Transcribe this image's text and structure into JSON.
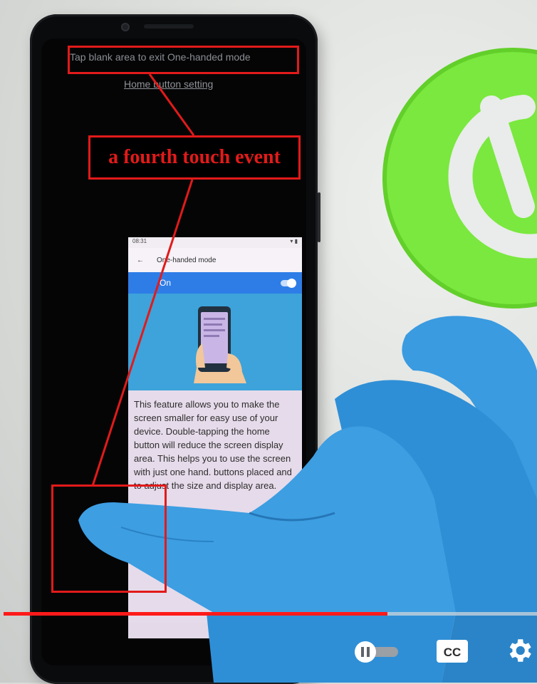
{
  "overlay": {
    "exit_hint": "Tap blank area to exit One-handed mode",
    "home_button_setting": "Home button setting",
    "touch_label": "a fourth touch event"
  },
  "mini_screen": {
    "status_time": "08:31",
    "header_title": "One-handed mode",
    "toggle_label": "On",
    "toggle_state": "on",
    "body": "This feature allows you to make the screen smaller for easy use of your device. Double-tapping the home button will reduce the screen display area. This helps you to use the screen with just one hand. buttons placed and to adjust the size and display area.",
    "colors": {
      "toggle_bar": "#2e7de7",
      "illustration_bg": "#3da3da",
      "background": "#e6dbea"
    }
  },
  "player": {
    "progress": 0.72,
    "progress_color": "#ff1a1a",
    "controls": {
      "autoplay_icon": "pause-toggle-icon",
      "captions_icon": "cc-icon",
      "settings_icon": "gear-icon"
    }
  },
  "annotation": {
    "color": "#e21a1a"
  }
}
